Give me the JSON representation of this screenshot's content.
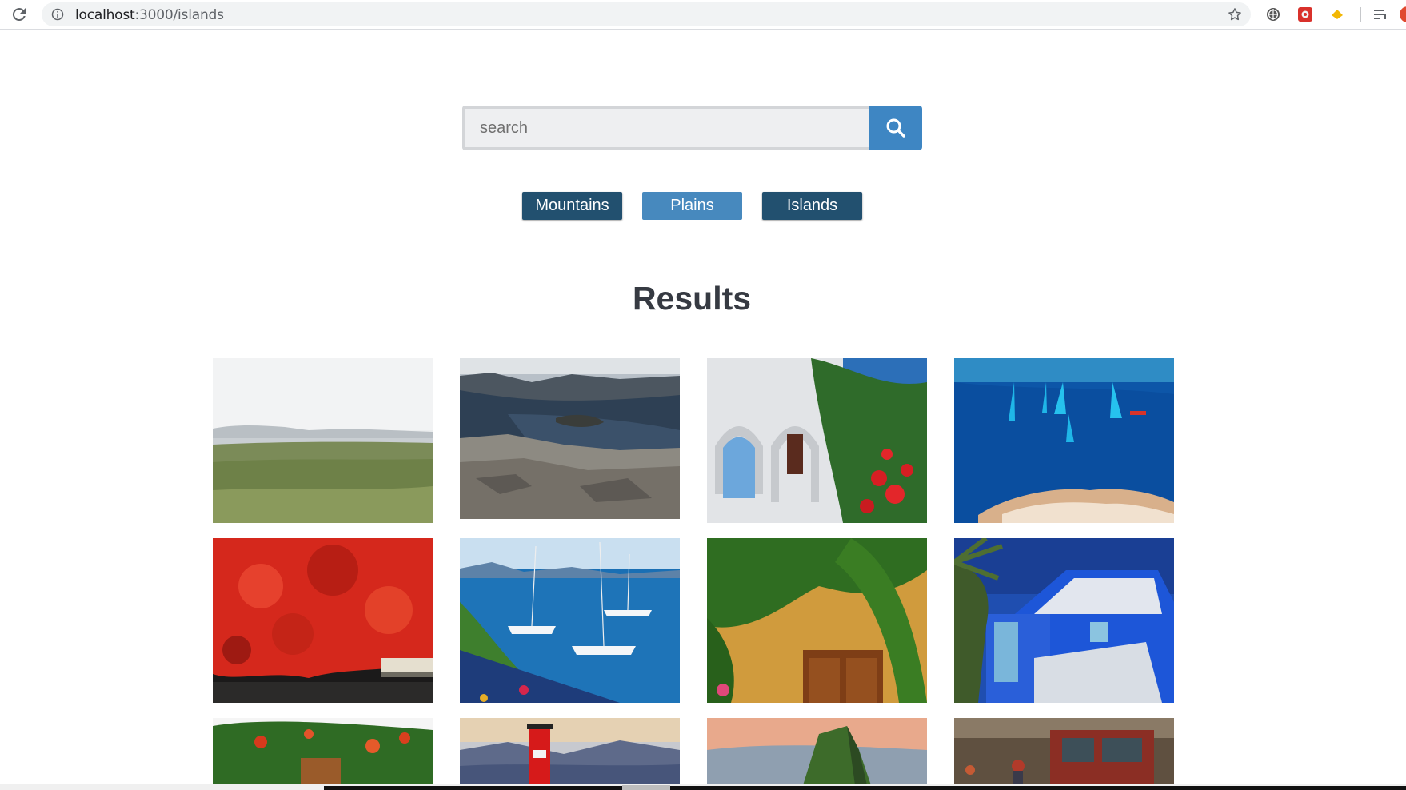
{
  "browser": {
    "url_host": "localhost",
    "url_path": ":3000/islands"
  },
  "search": {
    "placeholder": "search",
    "value": ""
  },
  "filters": [
    {
      "label": "Mountains"
    },
    {
      "label": "Plains"
    },
    {
      "label": "Islands"
    }
  ],
  "results": {
    "title": "Results"
  },
  "colors": {
    "search_button": "#3e86c3",
    "filter_dark": "#22506f",
    "filter_light": "#4789be",
    "title_text": "#363a42"
  }
}
